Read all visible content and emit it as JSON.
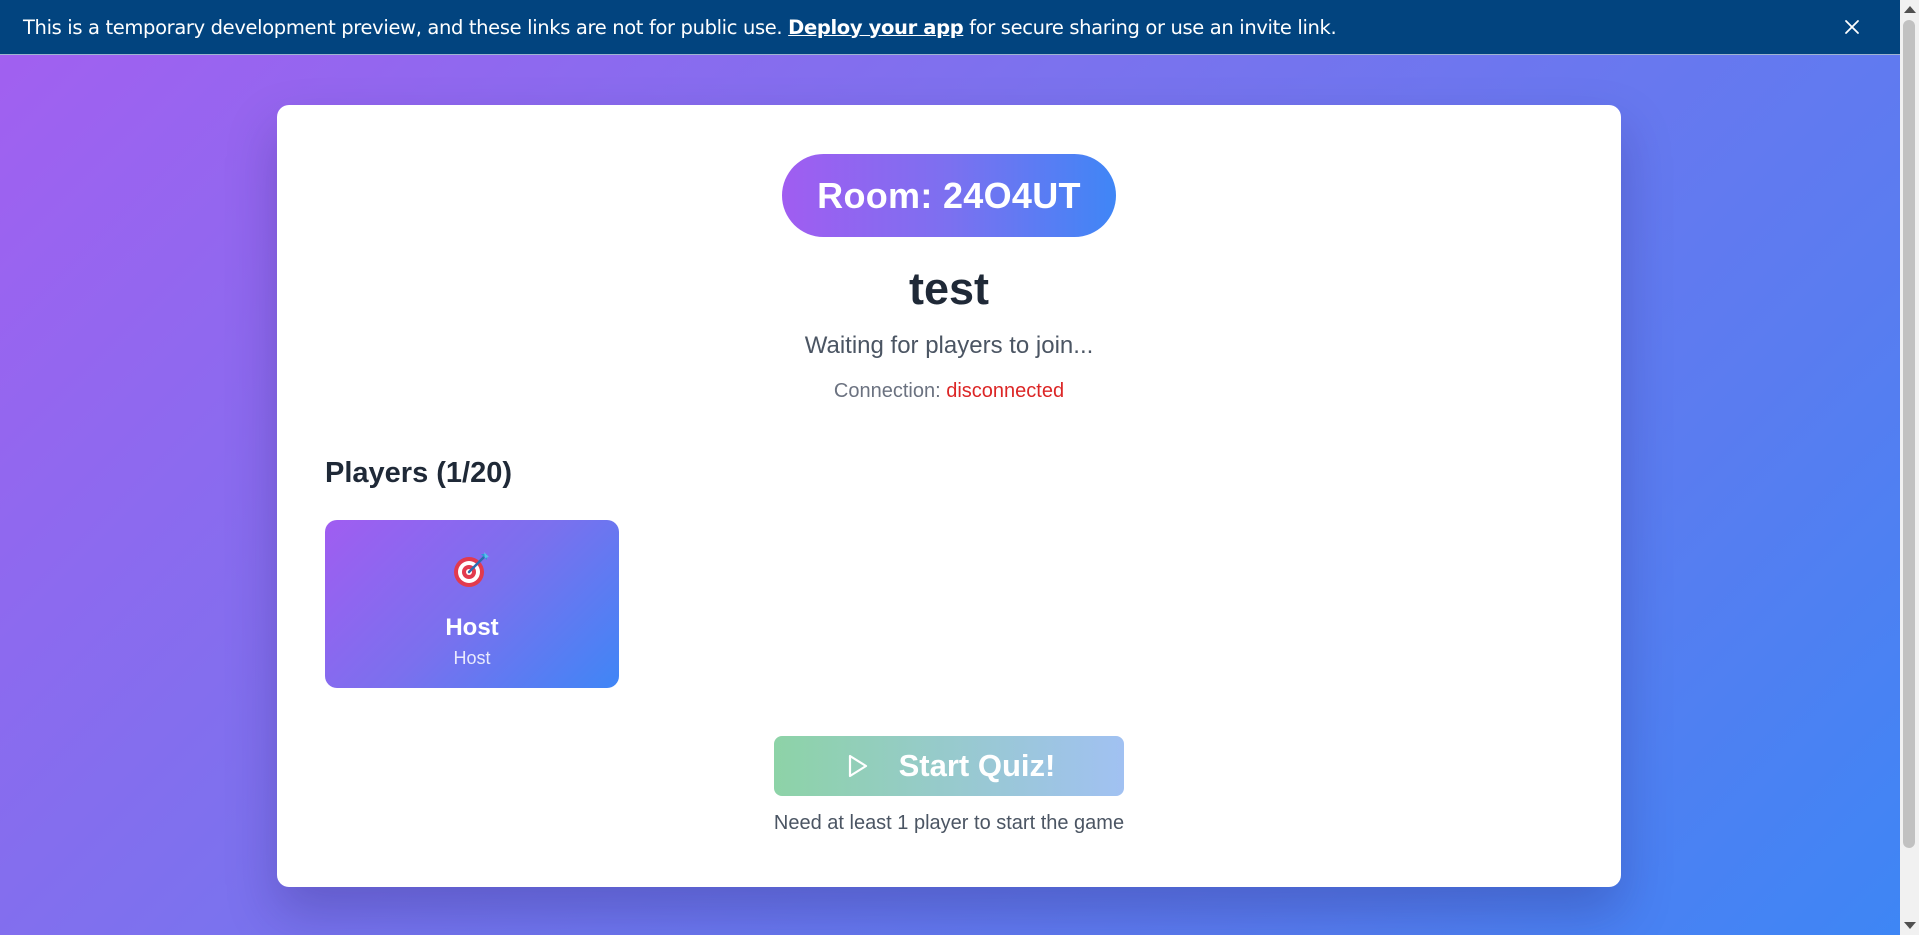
{
  "banner": {
    "text_before": "This is a temporary development preview, and these links are not for public use. ",
    "link_label": "Deploy your app",
    "text_after": " for secure sharing or use an invite link.",
    "close_icon": "close-icon"
  },
  "room": {
    "badge": "Room: 24O4UT",
    "title": "test",
    "subtitle": "Waiting for players to join...",
    "connection_label": "Connection: ",
    "connection_status": "disconnected"
  },
  "players": {
    "heading": "Players (1/20)",
    "list": [
      {
        "name": "Host",
        "role": "Host",
        "avatar": "dart-target-icon"
      }
    ]
  },
  "actions": {
    "start_label": "Start Quiz!",
    "start_icon": "play-icon",
    "hint": "Need at least 1 player to start the game"
  },
  "colors": {
    "banner_bg": "#02447f",
    "accent_purple": "#a05df1",
    "accent_blue": "#3f86f6",
    "status_disconnected": "#dc2626",
    "start_green": "#8dd3a7"
  }
}
